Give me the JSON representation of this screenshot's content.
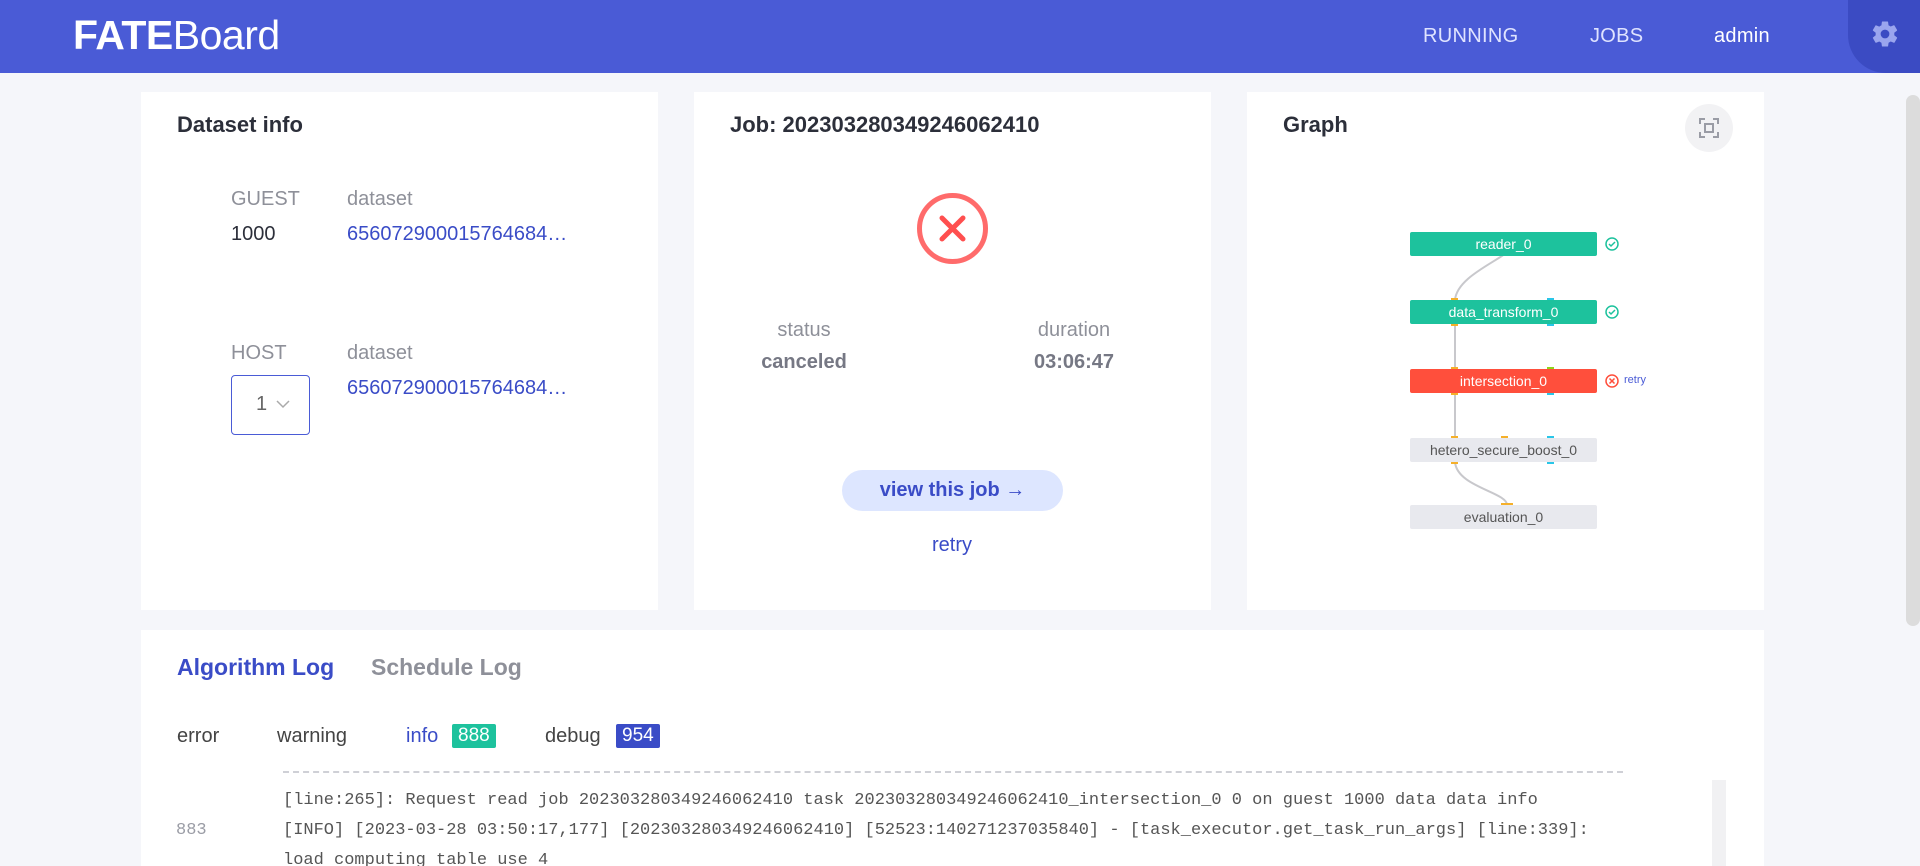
{
  "header": {
    "logo_bold": "FATE",
    "logo_light": "Board",
    "nav_running": "RUNNING",
    "nav_jobs": "JOBS",
    "user": "admin",
    "settings_icon": "gear-icon",
    "brand_color": "#4a5bd6"
  },
  "dataset": {
    "title": "Dataset info",
    "guest_label": "GUEST",
    "guest_id": "1000",
    "guest_dataset_label": "dataset",
    "guest_dataset": "656072900015764684…",
    "host_label": "HOST",
    "host_selected": "1",
    "host_dataset_label": "dataset",
    "host_dataset": "656072900015764684…"
  },
  "job": {
    "title": "Job: 20230328034924606241​0",
    "status_icon": "error-x-icon",
    "status_label": "status",
    "status_value": "canceled",
    "duration_label": "duration",
    "duration_value": "03:06:47",
    "view_button": "view this job →",
    "retry_link": "retry"
  },
  "graph": {
    "title": "Graph",
    "fullscreen_icon": "fullscreen-icon",
    "nodes": [
      {
        "name": "reader_0",
        "state": "success"
      },
      {
        "name": "data_transform_0",
        "state": "success"
      },
      {
        "name": "intersection_0",
        "state": "failed",
        "retry": "retry"
      },
      {
        "name": "hetero_secure_boost_0",
        "state": "pending"
      },
      {
        "name": "evaluation_0",
        "state": "pending"
      }
    ]
  },
  "log": {
    "tab_algorithm": "Algorithm Log",
    "tab_schedule": "Schedule Log",
    "level_error": "error",
    "level_warning": "warning",
    "level_info": "info",
    "level_info_count": "888",
    "level_debug": "debug",
    "level_debug_count": "954",
    "lines": [
      "[line:265]: Request read job 20230328034924606241​0 task 20230328034924606241​0_intersection_0 0 on guest 1000 data data info",
      "[INFO] [2023-03-28 03:50:17,177] [20230328034924606241​0] [52523:140271237035840] - [task_executor.get_task_run_args] [line:339]:",
      "load computing table use 4"
    ],
    "line_number": "883"
  }
}
